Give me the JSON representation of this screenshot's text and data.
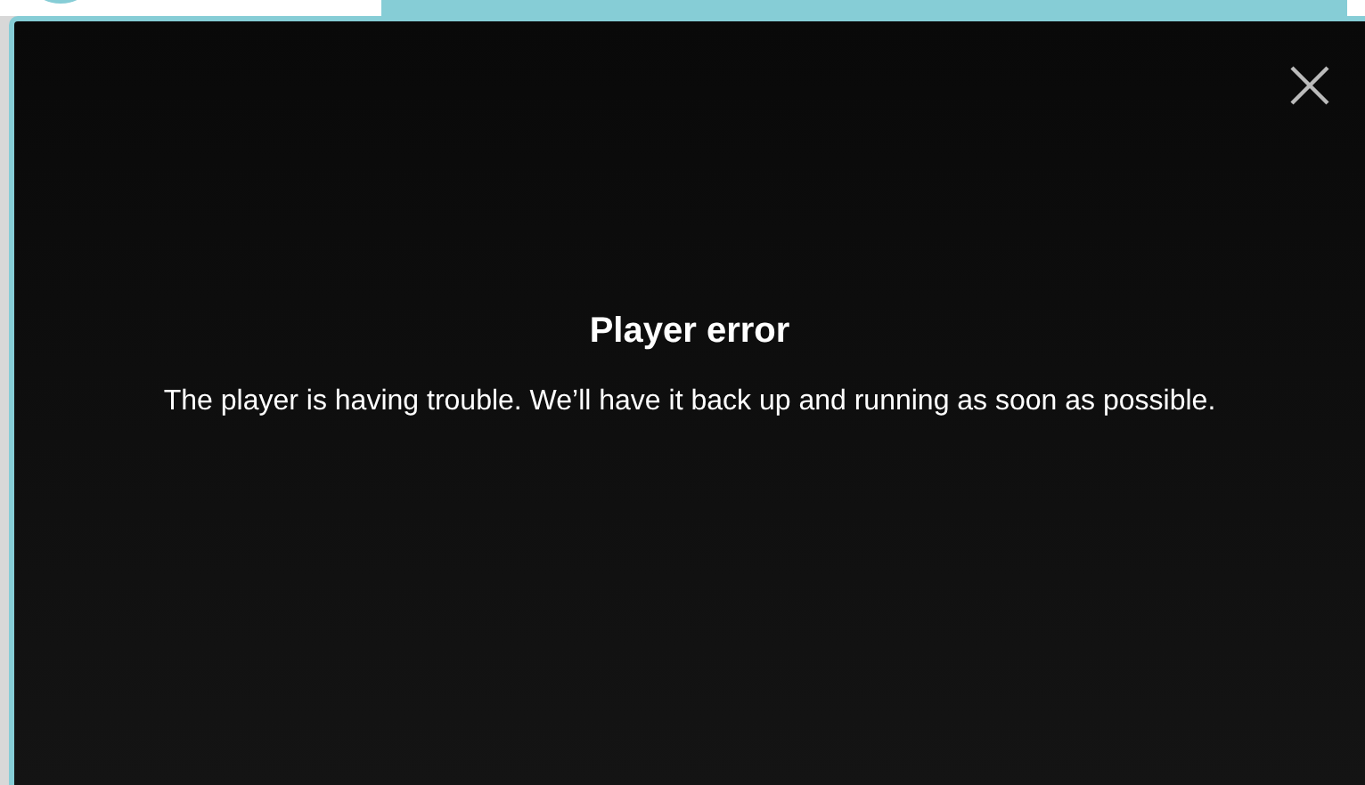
{
  "player": {
    "error_title": "Player error",
    "error_message": "The player is having trouble. We’ll have it back up and running as soon as possible."
  }
}
